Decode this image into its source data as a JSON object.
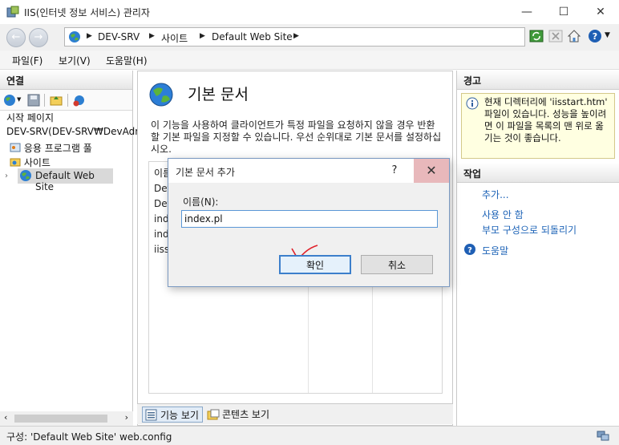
{
  "window": {
    "title": "IIS(인터넷 정보 서비스) 관리자"
  },
  "address": {
    "crumbs": [
      "DEV-SRV",
      "사이트",
      "Default Web Site"
    ]
  },
  "menu": [
    "파일(F)",
    "보기(V)",
    "도움말(H)"
  ],
  "connections": {
    "header": "연결",
    "tree": [
      "시작 페이지",
      "DEV-SRV(DEV-SRV₩DevAdm",
      "응용 프로그램 풀",
      "사이트",
      "Default Web Site"
    ]
  },
  "feature": {
    "title": "기본 문서",
    "description": "이 기능을 사용하여 클라이언트가 특정 파일을 요청하지 않을 경우 반환할 기본 파일을 지정할 수 있습니다. 우선 순위대로 기본 문서를 설정하십시오.",
    "list_header": "이름",
    "list_items": [
      "Def",
      "Def",
      "inde",
      "inde",
      "iisst"
    ]
  },
  "view_tabs": [
    "기능 보기",
    "콘텐츠 보기"
  ],
  "alerts": {
    "header": "경고",
    "message": "현재 디렉터리에 'iisstart.htm' 파일이 있습니다. 성능을 높이려면 이 파일을 목록의 맨 위로 옮기는 것이 좋습니다."
  },
  "actions": {
    "header": "작업",
    "items": [
      "추가...",
      "사용 안 함",
      "부모 구성으로 되돌리기",
      "도움말"
    ]
  },
  "status": {
    "text": "구성: 'Default Web Site' web.config"
  },
  "dialog": {
    "title": "기본 문서 추가",
    "help": "?",
    "name_label": "이름(N):",
    "name_value": "index.pl",
    "ok_label": "확인",
    "cancel_label": "취소"
  }
}
